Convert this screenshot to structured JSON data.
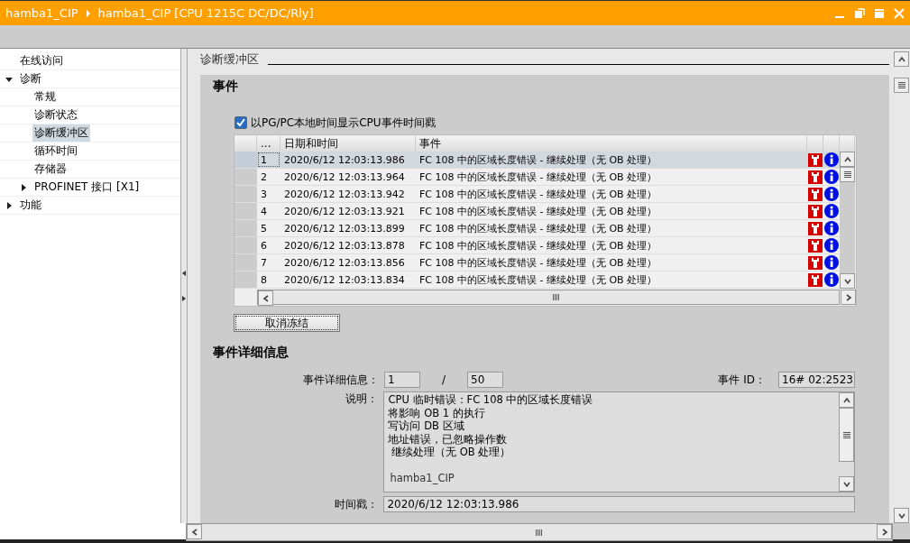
{
  "window": {
    "breadcrumb": [
      "hamba1_CIP",
      "hamba1_CIP [CPU 1215C DC/DC/Rly]"
    ]
  },
  "sidebar": {
    "items": [
      {
        "label": "在线访问",
        "selected": false
      },
      {
        "label": "诊断",
        "selected": false,
        "expanded": true,
        "children": [
          {
            "label": "常规",
            "selected": false
          },
          {
            "label": "诊断状态",
            "selected": false
          },
          {
            "label": "诊断缓冲区",
            "selected": true
          },
          {
            "label": "循环时间",
            "selected": false
          },
          {
            "label": "存储器",
            "selected": false
          },
          {
            "label": "PROFINET 接口 [X1]",
            "selected": false,
            "expanded": false
          }
        ]
      },
      {
        "label": "功能",
        "selected": false,
        "expanded": false
      }
    ]
  },
  "section_title": "诊断缓冲区",
  "events": {
    "heading": "事件",
    "checkbox": {
      "label": "以PG/PC本地时间显示CPU事件时间戳",
      "checked": true
    },
    "columns": [
      "...",
      "日期和时间",
      "事件"
    ],
    "rows": [
      {
        "index": "1",
        "datetime": "2020/6/12 12:03:13.986",
        "event": "FC 108 中的区域长度错误 - 继续处理（无 OB 处理）",
        "selected": true
      },
      {
        "index": "2",
        "datetime": "2020/6/12 12:03:13.964",
        "event": "FC 108 中的区域长度错误 - 继续处理（无 OB 处理）",
        "selected": false
      },
      {
        "index": "3",
        "datetime": "2020/6/12 12:03:13.942",
        "event": "FC 108 中的区域长度错误 - 继续处理（无 OB 处理）",
        "selected": false
      },
      {
        "index": "4",
        "datetime": "2020/6/12 12:03:13.921",
        "event": "FC 108 中的区域长度错误 - 继续处理（无 OB 处理）",
        "selected": false
      },
      {
        "index": "5",
        "datetime": "2020/6/12 12:03:13.899",
        "event": "FC 108 中的区域长度错误 - 继续处理（无 OB 处理）",
        "selected": false
      },
      {
        "index": "6",
        "datetime": "2020/6/12 12:03:13.878",
        "event": "FC 108 中的区域长度错误 - 继续处理（无 OB 处理）",
        "selected": false
      },
      {
        "index": "7",
        "datetime": "2020/6/12 12:03:13.856",
        "event": "FC 108 中的区域长度错误 - 继续处理（无 OB 处理）",
        "selected": false
      },
      {
        "index": "8",
        "datetime": "2020/6/12 12:03:13.834",
        "event": "FC 108 中的区域长度错误 - 继续处理（无 OB 处理）",
        "selected": false
      }
    ],
    "button": "取消冻结"
  },
  "details": {
    "heading": "事件详细信息",
    "detail_label": "事件详细信息：",
    "detail_value": "1",
    "separator": "/",
    "detail_total": "50",
    "id_label": "事件 ID：",
    "id_value": "16# 02:2523",
    "description_label": "说明：",
    "description_lines": [
      "CPU 临时错误：FC 108 中的区域长度错误",
      "将影响 OB 1 的执行",
      "写访问 DB 区域",
      "地址错误，已忽略操作数",
      " 继续处理（无 OB 处理）"
    ],
    "description_footer": "hamba1_CIP",
    "timestamp_label": "时间戳：",
    "timestamp_value": "2020/6/12 12:03:13.986"
  }
}
